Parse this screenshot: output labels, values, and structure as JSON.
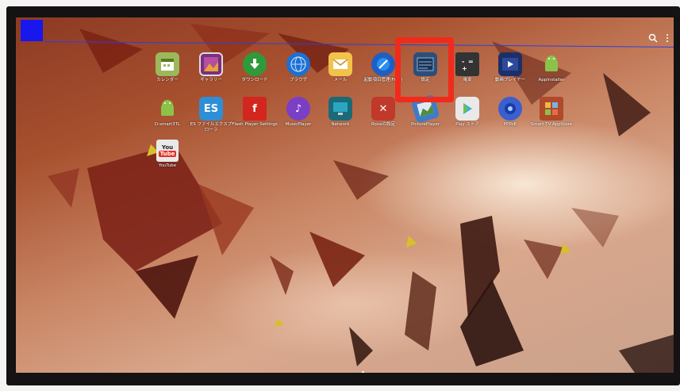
{
  "screen": {
    "search_icon": "search-icon",
    "overflow_icon": "more-vert-icon"
  },
  "apps": [
    {
      "label": "カレンダー",
      "icon": "calendar-icon",
      "color": "#9db85a"
    },
    {
      "label": "ギャラリー",
      "icon": "gallery-icon",
      "color": "#7a2f7f"
    },
    {
      "label": "ダウンロード",
      "icon": "download-icon",
      "color": "#2f9a3a"
    },
    {
      "label": "ブラウザ",
      "icon": "browser-globe-icon",
      "color": "#1f6fd1"
    },
    {
      "label": "メール",
      "icon": "email-icon",
      "color": "#f2c24a"
    },
    {
      "label": "起動項目管理(Free)",
      "icon": "startup-manager-icon",
      "color": "#1f5fc4"
    },
    {
      "label": "設定",
      "icon": "settings-icon",
      "color": "#2c4f7a"
    },
    {
      "label": "電卓",
      "icon": "calculator-icon",
      "color": "#333333"
    },
    {
      "label": "動画プレイヤー",
      "icon": "video-player-icon",
      "color": "#1d2f6a"
    },
    {
      "label": "AppInstaller",
      "icon": "app-installer-icon",
      "color": "#8bc34a"
    },
    {
      "label": "D-smart3TL",
      "icon": "android-icon",
      "color": "#8bc34a"
    },
    {
      "label": "ES ファイルエクスプローラ",
      "icon": "es-file-explorer-icon",
      "color": "#2f8fd6"
    },
    {
      "label": "Flash Player Settings",
      "icon": "flash-player-icon",
      "color": "#d3261e"
    },
    {
      "label": "MusicPlayer",
      "icon": "music-player-icon",
      "color": "#7b3fc6"
    },
    {
      "label": "Network",
      "icon": "network-icon",
      "color": "#1b6a78"
    },
    {
      "label": "Rovaの設定",
      "icon": "rova-settings-icon",
      "color": "#c0392b"
    },
    {
      "label": "PicturePlayer",
      "icon": "picture-player-icon",
      "color": "#3f7cc8"
    },
    {
      "label": "Play ストア",
      "icon": "play-store-icon",
      "color": "#e9e9e9"
    },
    {
      "label": "PPPoE",
      "icon": "pppoe-icon",
      "color": "#3a5fcf"
    },
    {
      "label": "Smart TV AppStore",
      "icon": "smart-tv-appstore-icon",
      "color": "#b04a2a"
    },
    {
      "label": "YouTube",
      "icon": "youtube-icon",
      "color": "#e9e9e9"
    }
  ],
  "highlight": {
    "target": "設定",
    "color": "#f02b1c"
  }
}
